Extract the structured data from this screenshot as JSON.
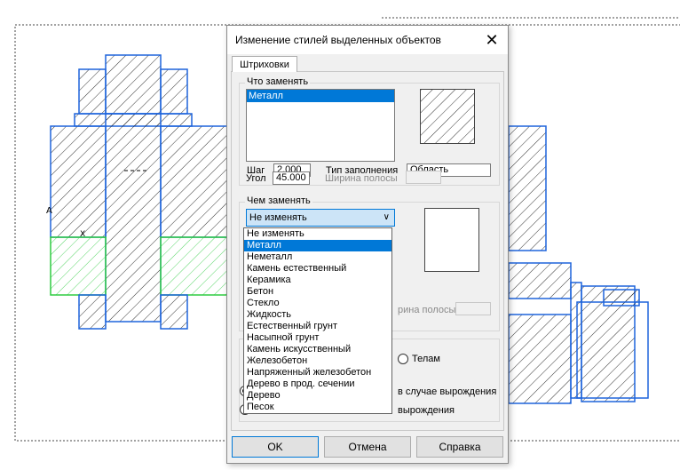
{
  "dialog": {
    "title": "Изменение стилей выделенных объектов",
    "close_glyph": "✕",
    "tab_label": "Штриховки"
  },
  "what_replace": {
    "group_label": "Что заменять",
    "list_items": [
      "Металл"
    ],
    "step_label": "Шаг",
    "step_value": "2.000",
    "angle_label": "Угол",
    "angle_value": "45.000",
    "fill_type_label": "Тип заполнения",
    "fill_type_value": "Область",
    "stripe_width_label": "Ширина полосы"
  },
  "replace_with": {
    "group_label": "Чем заменять",
    "combo_value": "Не изменять",
    "options": [
      "Не изменять",
      "Металл",
      "Неметалл",
      "Камень естественный",
      "Керамика",
      "Бетон",
      "Стекло",
      "Жидкость",
      "Естественный грунт",
      "Насыпной грунт",
      "Камень искусственный",
      "Железобетон",
      "Напряженный железобетон",
      "Дерево в прод. сечении",
      "Дерево",
      "Песок"
    ],
    "selected_index": 1,
    "stripe_width_partial": "рина полосы"
  },
  "apply_to": {
    "bodies_label": "Телам",
    "degen_label_1": "в случае вырождения",
    "degen_label_2": "вырождения"
  },
  "buttons": {
    "ok": "OK",
    "cancel": "Отмена",
    "help": "Справка"
  },
  "colors": {
    "accent": "#0078d7",
    "selection_outline": "#1e64dc",
    "hatch": "#000000",
    "green_hatch": "#2ecc40"
  }
}
